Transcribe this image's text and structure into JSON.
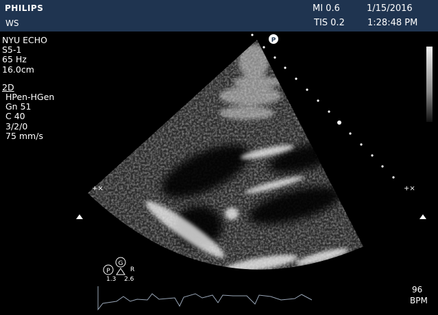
{
  "header": {
    "brand": "PHILIPS",
    "station": "WS",
    "mi": "MI 0.6",
    "tis": "TIS 0.2",
    "date": "1/15/2016",
    "time": "1:28:48 PM"
  },
  "settings": {
    "institution": "NYU ECHO",
    "probe": "S5-1",
    "frame_rate": "65 Hz",
    "depth": "16.0cm",
    "mode": "2D",
    "preset": "HPen-HGen",
    "gain": "Gn 51",
    "compression": "C 40",
    "persistence": "3/2/0",
    "sweep": "75 mm/s"
  },
  "markers": {
    "probe_marker": "P",
    "power_marker": "P",
    "gain_marker": "G",
    "r_label": "R",
    "power_value": "1.3",
    "gain_value": "2.6"
  },
  "heart_rate": {
    "value": "96",
    "unit": "BPM"
  }
}
